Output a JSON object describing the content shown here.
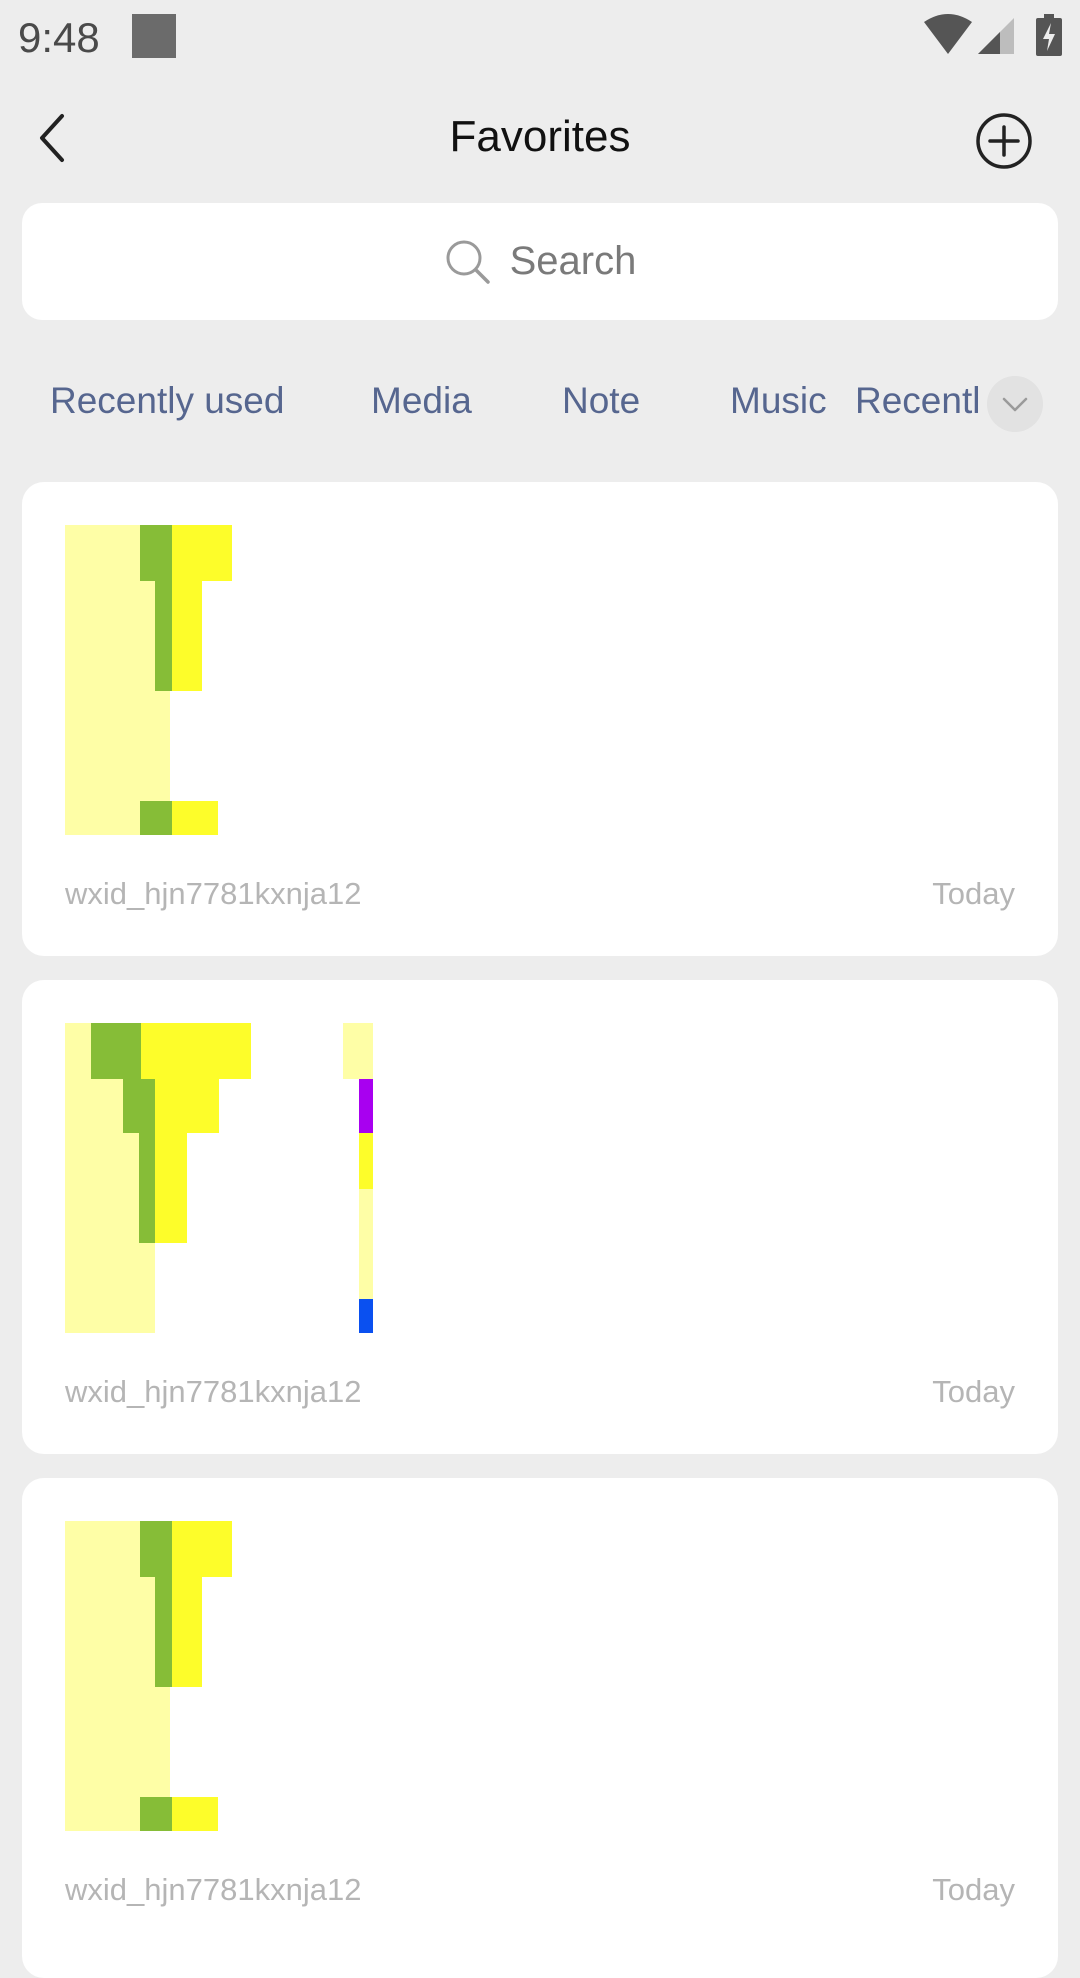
{
  "status_bar": {
    "time": "9:48",
    "icons": [
      "notification-square-icon",
      "wifi-icon",
      "cellular-signal-icon",
      "battery-charging-icon"
    ]
  },
  "header": {
    "title": "Favorites",
    "back_icon": "chevron-left-icon",
    "add_icon": "plus-circle-icon"
  },
  "search": {
    "placeholder": "Search",
    "icon": "search-icon"
  },
  "tabs": {
    "items": [
      {
        "label": "Recently used"
      },
      {
        "label": "Media"
      },
      {
        "label": "Note"
      },
      {
        "label": "Music"
      },
      {
        "label": "Recentl"
      }
    ],
    "more_icon": "chevron-down-icon"
  },
  "items": [
    {
      "user": "wxid_hjn7781kxnja12",
      "date": "Today"
    },
    {
      "user": "wxid_hjn7781kxnja12",
      "date": "Today"
    },
    {
      "user": "wxid_hjn7781kxnja12",
      "date": "Today"
    }
  ],
  "colors": {
    "background": "#ededed",
    "card": "#ffffff",
    "tab_text": "#56668f",
    "meta_text": "#b5b5b5",
    "thumb_pale_yellow": "#fefea6",
    "thumb_yellow": "#fdfd2a",
    "thumb_green": "#86bd37",
    "thumb_purple": "#a800f0",
    "thumb_blue": "#0a50f0"
  }
}
